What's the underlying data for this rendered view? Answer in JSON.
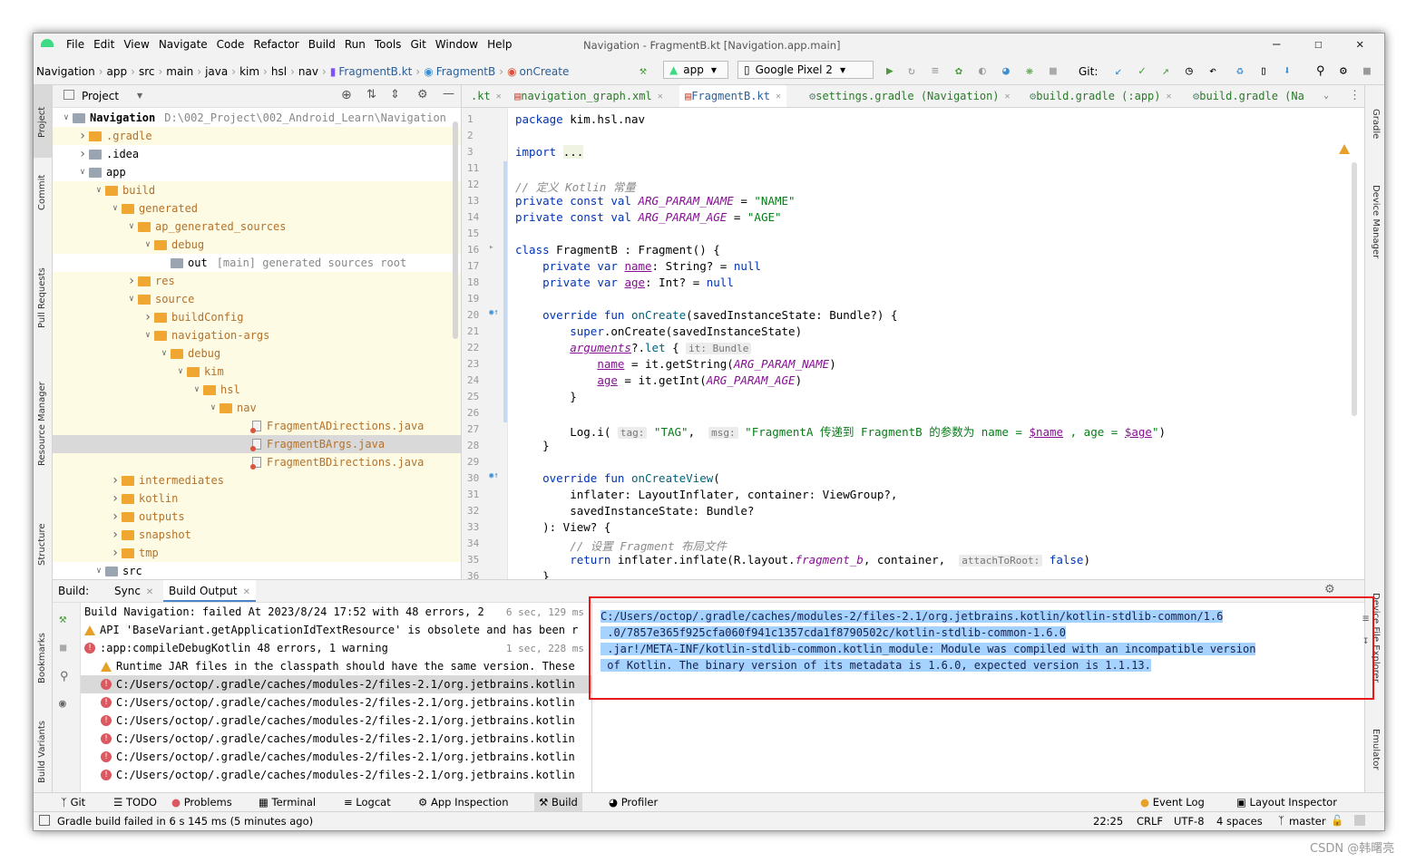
{
  "app": {
    "window_title": "Navigation - FragmentB.kt [Navigation.app.main]",
    "menu": [
      "File",
      "Edit",
      "View",
      "Navigate",
      "Code",
      "Refactor",
      "Build",
      "Run",
      "Tools",
      "Git",
      "Window",
      "Help"
    ]
  },
  "breadcrumbs": [
    "Navigation",
    "app",
    "src",
    "main",
    "java",
    "kim",
    "hsl",
    "nav",
    "FragmentB.kt",
    "FragmentB",
    "onCreate"
  ],
  "toolbar": {
    "run_config": "app",
    "device": "Google Pixel 2",
    "git_label": "Git:"
  },
  "left_stripe": [
    "Project",
    "Commit",
    "Pull Requests",
    "Resource Manager",
    "Structure",
    "Bookmarks",
    "Build Variants"
  ],
  "right_stripe": [
    "Gradle",
    "Device Manager",
    "Device File Explorer",
    "Emulator"
  ],
  "project_panel": {
    "title": "Project",
    "tree": [
      {
        "depth": 0,
        "arrow": "v",
        "icon": "module",
        "label": "Navigation",
        "extra": "D:\\002_Project\\002_Android_Learn\\Navigation",
        "style": ""
      },
      {
        "depth": 1,
        "arrow": ">",
        "icon": "folder",
        "label": ".gradle",
        "extra": "",
        "style": "hl"
      },
      {
        "depth": 1,
        "arrow": ">",
        "icon": "folder-gray",
        "label": ".idea",
        "extra": "",
        "style": ""
      },
      {
        "depth": 1,
        "arrow": "v",
        "icon": "module",
        "label": "app",
        "extra": "",
        "style": ""
      },
      {
        "depth": 2,
        "arrow": "v",
        "icon": "folder",
        "label": "build",
        "extra": "",
        "style": "hl"
      },
      {
        "depth": 3,
        "arrow": "v",
        "icon": "folder",
        "label": "generated",
        "extra": "",
        "style": "hl"
      },
      {
        "depth": 4,
        "arrow": "v",
        "icon": "folder",
        "label": "ap_generated_sources",
        "extra": "",
        "style": "hl"
      },
      {
        "depth": 5,
        "arrow": "v",
        "icon": "folder",
        "label": "debug",
        "extra": "",
        "style": "hl"
      },
      {
        "depth": 6,
        "arrow": "",
        "icon": "folder-gray",
        "label": "out",
        "extra": "[main]  generated sources root",
        "style": ""
      },
      {
        "depth": 4,
        "arrow": ">",
        "icon": "folder",
        "label": "res",
        "extra": "",
        "style": "hl"
      },
      {
        "depth": 4,
        "arrow": "v",
        "icon": "folder",
        "label": "source",
        "extra": "",
        "style": "hl"
      },
      {
        "depth": 5,
        "arrow": ">",
        "icon": "folder",
        "label": "buildConfig",
        "extra": "",
        "style": "hl"
      },
      {
        "depth": 5,
        "arrow": "v",
        "icon": "folder",
        "label": "navigation-args",
        "extra": "",
        "style": "hl"
      },
      {
        "depth": 6,
        "arrow": "v",
        "icon": "folder",
        "label": "debug",
        "extra": "",
        "style": "hl"
      },
      {
        "depth": 7,
        "arrow": "v",
        "icon": "folder",
        "label": "kim",
        "extra": "",
        "style": "hl"
      },
      {
        "depth": 8,
        "arrow": "v",
        "icon": "folder",
        "label": "hsl",
        "extra": "",
        "style": "hl"
      },
      {
        "depth": 9,
        "arrow": "v",
        "icon": "folder",
        "label": "nav",
        "extra": "",
        "style": "hl"
      },
      {
        "depth": 11,
        "arrow": "",
        "icon": "java",
        "label": "FragmentADirections.java",
        "extra": "",
        "style": "hl"
      },
      {
        "depth": 11,
        "arrow": "",
        "icon": "java",
        "label": "FragmentBArgs.java",
        "extra": "",
        "style": "sel"
      },
      {
        "depth": 11,
        "arrow": "",
        "icon": "java",
        "label": "FragmentBDirections.java",
        "extra": "",
        "style": "hl"
      },
      {
        "depth": 3,
        "arrow": ">",
        "icon": "folder",
        "label": "intermediates",
        "extra": "",
        "style": "hl"
      },
      {
        "depth": 3,
        "arrow": ">",
        "icon": "folder",
        "label": "kotlin",
        "extra": "",
        "style": "hl"
      },
      {
        "depth": 3,
        "arrow": ">",
        "icon": "folder",
        "label": "outputs",
        "extra": "",
        "style": "hl"
      },
      {
        "depth": 3,
        "arrow": ">",
        "icon": "folder",
        "label": "snapshot",
        "extra": "",
        "style": "hl"
      },
      {
        "depth": 3,
        "arrow": ">",
        "icon": "folder",
        "label": "tmp",
        "extra": "",
        "style": "hl"
      },
      {
        "depth": 2,
        "arrow": "v",
        "icon": "folder-gray",
        "label": "src",
        "extra": "",
        "style": ""
      }
    ]
  },
  "editor_tabs": [
    {
      "label": ".kt",
      "active": false
    },
    {
      "label": "navigation_graph.xml",
      "active": false
    },
    {
      "label": "FragmentB.kt",
      "active": true
    },
    {
      "label": "settings.gradle (Navigation)",
      "active": false
    },
    {
      "label": "build.gradle (:app)",
      "active": false
    },
    {
      "label": "build.gradle (Na",
      "active": false
    }
  ],
  "code_lines": [
    {
      "n": "1",
      "html": "<span class='kw'>package</span> kim.hsl.nav"
    },
    {
      "n": "2",
      "html": ""
    },
    {
      "n": "3",
      "html": "<span class='kw'>import</span> <span style='background:#eef3e2'>...</span>"
    },
    {
      "n": "11",
      "html": ""
    },
    {
      "n": "12",
      "html": "<span class='cm'>// 定义 Kotlin 常量</span>"
    },
    {
      "n": "13",
      "html": "<span class='kw'>private const val</span> <span class='con'>ARG_PARAM_NAME</span> = <span class='str'>\"NAME\"</span>"
    },
    {
      "n": "14",
      "html": "<span class='kw'>private const val</span> <span class='con'>ARG_PARAM_AGE</span> = <span class='str'>\"AGE\"</span>"
    },
    {
      "n": "15",
      "html": ""
    },
    {
      "n": "16",
      "html": "<span class='kw'>class</span> FragmentB : Fragment() {"
    },
    {
      "n": "17",
      "html": "    <span class='kw'>private var</span> <span class='prop'>name</span>: String? = <span class='kw'>null</span>"
    },
    {
      "n": "18",
      "html": "    <span class='kw'>private var</span> <span class='prop'>age</span>: Int? = <span class='kw'>null</span>"
    },
    {
      "n": "19",
      "html": ""
    },
    {
      "n": "20",
      "html": "    <span class='kw'>override fun</span> <span class='fn'>onCreate</span>(savedInstanceState: Bundle?) {"
    },
    {
      "n": "21",
      "html": "        <span class='kw'>super</span>.onCreate(savedInstanceState)"
    },
    {
      "n": "22",
      "html": "        <span class='prop' style='font-style:italic'>arguments</span>?.<span class='fn'>let</span> { <span class='hint'>it: Bundle</span>"
    },
    {
      "n": "23",
      "html": "            <span class='prop'>name</span> = it.getString(<span class='con'>ARG_PARAM_NAME</span>)"
    },
    {
      "n": "24",
      "html": "            <span class='prop'>age</span> = it.getInt(<span class='con'>ARG_PARAM_AGE</span>)"
    },
    {
      "n": "25",
      "html": "        }"
    },
    {
      "n": "26",
      "html": ""
    },
    {
      "n": "27",
      "html": "        Log.i( <span class='hint'>tag:</span> <span class='str'>\"TAG\"</span>,  <span class='hint'>msg:</span> <span class='str'>\"FragmentA 传递到 FragmentB 的参数为 name = </span><span class='tmpl'>$name</span><span class='str'> , age = </span><span class='tmpl'>$age</span><span class='str'>\"</span>)"
    },
    {
      "n": "28",
      "html": "    }"
    },
    {
      "n": "29",
      "html": ""
    },
    {
      "n": "30",
      "html": "    <span class='kw'>override fun</span> <span class='fn'>onCreateView</span>("
    },
    {
      "n": "31",
      "html": "        inflater: LayoutInflater, container: ViewGroup?,"
    },
    {
      "n": "32",
      "html": "        savedInstanceState: Bundle?"
    },
    {
      "n": "33",
      "html": "    ): View? {"
    },
    {
      "n": "34",
      "html": "        <span class='cm'>// 设置 Fragment 布局文件</span>"
    },
    {
      "n": "35",
      "html": "        <span class='kw'>return</span> inflater.inflate(R.layout.<span class='con'>fragment_b</span>, container,  <span class='hint'>attachToRoot:</span> <span class='kw'>false</span>)"
    },
    {
      "n": "36",
      "html": "    }"
    }
  ],
  "build_panel": {
    "label": "Build:",
    "tabs": [
      "Sync",
      "Build Output"
    ],
    "rows": [
      {
        "icon": "hammer",
        "text": "Build Navigation: failed At 2023/8/24 17:52 with 48 errors, 2",
        "time": "6 sec, 129 ms",
        "indent": 0,
        "sel": false
      },
      {
        "icon": "warn",
        "text": "API 'BaseVariant.getApplicationIdTextResource' is obsolete and has been r",
        "time": "",
        "indent": 0,
        "sel": false
      },
      {
        "icon": "err",
        "text": ":app:compileDebugKotlin  48 errors, 1 warning",
        "time": "1 sec, 228 ms",
        "indent": 0,
        "sel": false
      },
      {
        "icon": "warn",
        "text": "Runtime JAR files in the classpath should have the same version. These",
        "time": "",
        "indent": 1,
        "sel": false
      },
      {
        "icon": "err",
        "text": "C:/Users/octop/.gradle/caches/modules-2/files-2.1/org.jetbrains.kotlin",
        "time": "",
        "indent": 1,
        "sel": true
      },
      {
        "icon": "err",
        "text": "C:/Users/octop/.gradle/caches/modules-2/files-2.1/org.jetbrains.kotlin",
        "time": "",
        "indent": 1,
        "sel": false
      },
      {
        "icon": "err",
        "text": "C:/Users/octop/.gradle/caches/modules-2/files-2.1/org.jetbrains.kotlin",
        "time": "",
        "indent": 1,
        "sel": false
      },
      {
        "icon": "err",
        "text": "C:/Users/octop/.gradle/caches/modules-2/files-2.1/org.jetbrains.kotlin",
        "time": "",
        "indent": 1,
        "sel": false
      },
      {
        "icon": "err",
        "text": "C:/Users/octop/.gradle/caches/modules-2/files-2.1/org.jetbrains.kotlin",
        "time": "",
        "indent": 1,
        "sel": false
      },
      {
        "icon": "err",
        "text": "C:/Users/octop/.gradle/caches/modules-2/files-2.1/org.jetbrains.kotlin",
        "time": "",
        "indent": 1,
        "sel": false
      }
    ],
    "message": [
      "C:/Users/octop/.gradle/caches/modules-2/files-2.1/org.jetbrains.kotlin/kotlin-stdlib-common/1.6",
      " .0/7857e365f925cfa060f941c1357cda1f8790502c/kotlin-stdlib-common-1.6.0",
      " .jar!/META-INF/kotlin-stdlib-common.kotlin_module: Module was compiled with an incompatible version",
      " of Kotlin. The binary version of its metadata is 1.6.0, expected version is 1.1.13."
    ]
  },
  "bottom_tabs": [
    "Git",
    "TODO",
    "Problems",
    "Terminal",
    "Logcat",
    "App Inspection",
    "Build",
    "Profiler",
    "Event Log",
    "Layout Inspector"
  ],
  "status": {
    "message": "Gradle build failed in 6 s 145 ms (5 minutes ago)",
    "position": "22:25",
    "line_sep": "CRLF",
    "encoding": "UTF-8",
    "indent": "4 spaces",
    "branch": "master"
  },
  "watermark": "CSDN @韩曙亮",
  "colors": {
    "accent": "#4a86c8",
    "error": "#db5860",
    "warning": "#e7a12a",
    "highlight_frame": "#e51919",
    "selection": "#a6d2ff"
  }
}
